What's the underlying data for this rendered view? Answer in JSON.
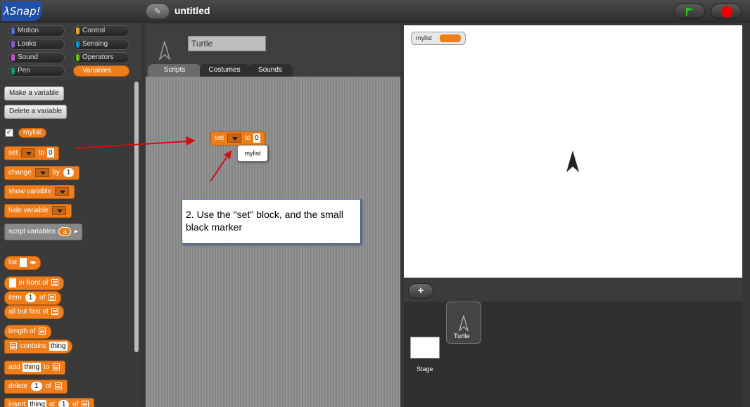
{
  "app": {
    "logo": "λSnap!",
    "project_title": "untitled"
  },
  "categories": [
    {
      "label": "Motion",
      "color": "#4a6cd4"
    },
    {
      "label": "Control",
      "color": "#e6a822"
    },
    {
      "label": "Looks",
      "color": "#8a55d7"
    },
    {
      "label": "Sensing",
      "color": "#0494dc"
    },
    {
      "label": "Sound",
      "color": "#cf4ad9"
    },
    {
      "label": "Operators",
      "color": "#62c213"
    },
    {
      "label": "Pen",
      "color": "#00a178"
    },
    {
      "label": "Variables",
      "color": "#ee7d16"
    }
  ],
  "palette": {
    "make_variable": "Make a variable",
    "delete_variable": "Delete a variable",
    "var_name": "mylist",
    "set": {
      "label": "set",
      "to": "to",
      "value": "0"
    },
    "change": {
      "label": "change",
      "by": "by",
      "value": "1"
    },
    "show_variable": "show variable",
    "hide_variable": "hide variable",
    "script_variables": {
      "label": "script variables",
      "var": "a"
    },
    "list": "list",
    "in_front_of": "in front of",
    "item": {
      "label": "item",
      "index": "1",
      "of": "of"
    },
    "all_but_first_of": "all but first of",
    "length_of": "length of",
    "contains": {
      "label": "contains",
      "value": "thing"
    },
    "add": {
      "label": "add",
      "value": "thing",
      "to": "to"
    },
    "delete": {
      "label": "delete",
      "index": "1",
      "of": "of"
    },
    "insert": {
      "label": "insert",
      "value": "thing",
      "at": "at",
      "index": "1",
      "of": "of"
    }
  },
  "sprite": {
    "name": "Turtle"
  },
  "tabs": [
    "Scripts",
    "Costumes",
    "Sounds"
  ],
  "script": {
    "set_label": "set",
    "to_label": "to",
    "value": "0",
    "dropdown_option": "mylist"
  },
  "callout": {
    "text": "2. Use the \"set\" block, and  the small black marker"
  },
  "stage": {
    "watcher_label": "mylist"
  },
  "corral": {
    "stage_label": "Stage",
    "sprite_label": "Turtle"
  },
  "colors": {
    "variables": "#ef7d1a",
    "arrow": "#cc1111",
    "accent_blue": "#1f4fa8"
  }
}
